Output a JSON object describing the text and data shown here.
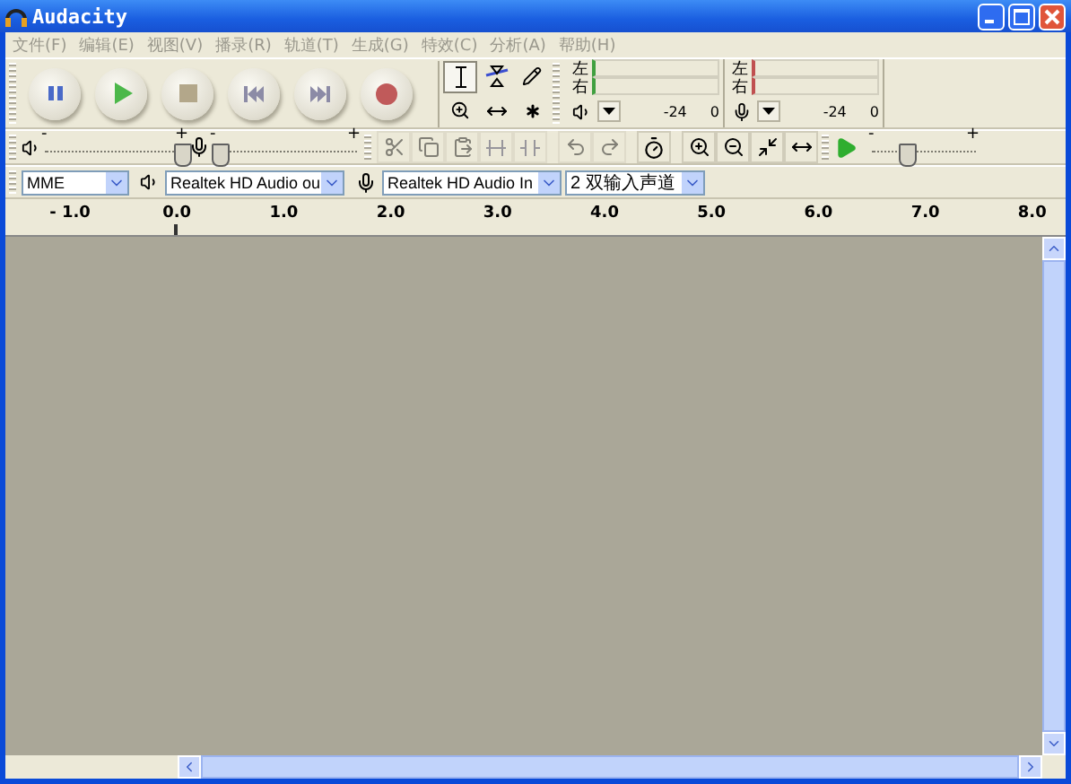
{
  "window": {
    "title": "Audacity"
  },
  "menu": [
    {
      "label": "文件(F)"
    },
    {
      "label": "编辑(E)"
    },
    {
      "label": "视图(V)"
    },
    {
      "label": "播录(R)"
    },
    {
      "label": "轨道(T)"
    },
    {
      "label": "生成(G)"
    },
    {
      "label": "特效(C)"
    },
    {
      "label": "分析(A)"
    },
    {
      "label": "帮助(H)"
    }
  ],
  "transport": [
    {
      "kind": "pause"
    },
    {
      "kind": "play"
    },
    {
      "kind": "stop"
    },
    {
      "kind": "skip_start"
    },
    {
      "kind": "skip_end"
    },
    {
      "kind": "record"
    }
  ],
  "tools": [
    {
      "kind": "select",
      "selected": true
    },
    {
      "kind": "envelope",
      "selected": false
    },
    {
      "kind": "draw",
      "selected": false
    },
    {
      "kind": "zoom",
      "selected": false
    },
    {
      "kind": "timeshift",
      "selected": false
    },
    {
      "kind": "multi",
      "selected": false
    }
  ],
  "meters": [
    {
      "kind": "playback",
      "channels": [
        "左",
        "右"
      ],
      "ticks": [
        "-24",
        "0"
      ]
    },
    {
      "kind": "record",
      "channels": [
        "左",
        "右"
      ],
      "ticks": [
        "-24",
        "0"
      ]
    }
  ],
  "mixer": {
    "output": {
      "min_label": "-",
      "max_label": "+",
      "level": 0.97
    },
    "input": {
      "min_label": "-",
      "max_label": "+",
      "level": 0.04
    }
  },
  "edit_buttons": [
    {
      "kind": "cut",
      "disabled": true
    },
    {
      "kind": "copy",
      "disabled": true
    },
    {
      "kind": "paste",
      "disabled": true
    },
    {
      "kind": "trim",
      "disabled": true
    },
    {
      "kind": "silence",
      "disabled": true
    },
    {
      "kind": "undo",
      "disabled": true
    },
    {
      "kind": "redo",
      "disabled": true
    },
    {
      "kind": "timer",
      "disabled": false
    },
    {
      "kind": "zoom_in",
      "disabled": false
    },
    {
      "kind": "zoom_out",
      "disabled": false
    },
    {
      "kind": "fit_selection",
      "disabled": false
    },
    {
      "kind": "fit_project",
      "disabled": false
    }
  ],
  "play_at_speed": {
    "min_label": "-",
    "max_label": "+",
    "level": 0.33
  },
  "devices": {
    "host": "MME",
    "output": "Realtek HD Audio ou",
    "input": "Realtek HD Audio In",
    "channels": "2 双输入声道"
  },
  "ruler": {
    "ticks": [
      "- 1.0",
      "0.0",
      "1.0",
      "2.0",
      "3.0",
      "4.0",
      "5.0",
      "6.0",
      "7.0",
      "8.0"
    ]
  }
}
